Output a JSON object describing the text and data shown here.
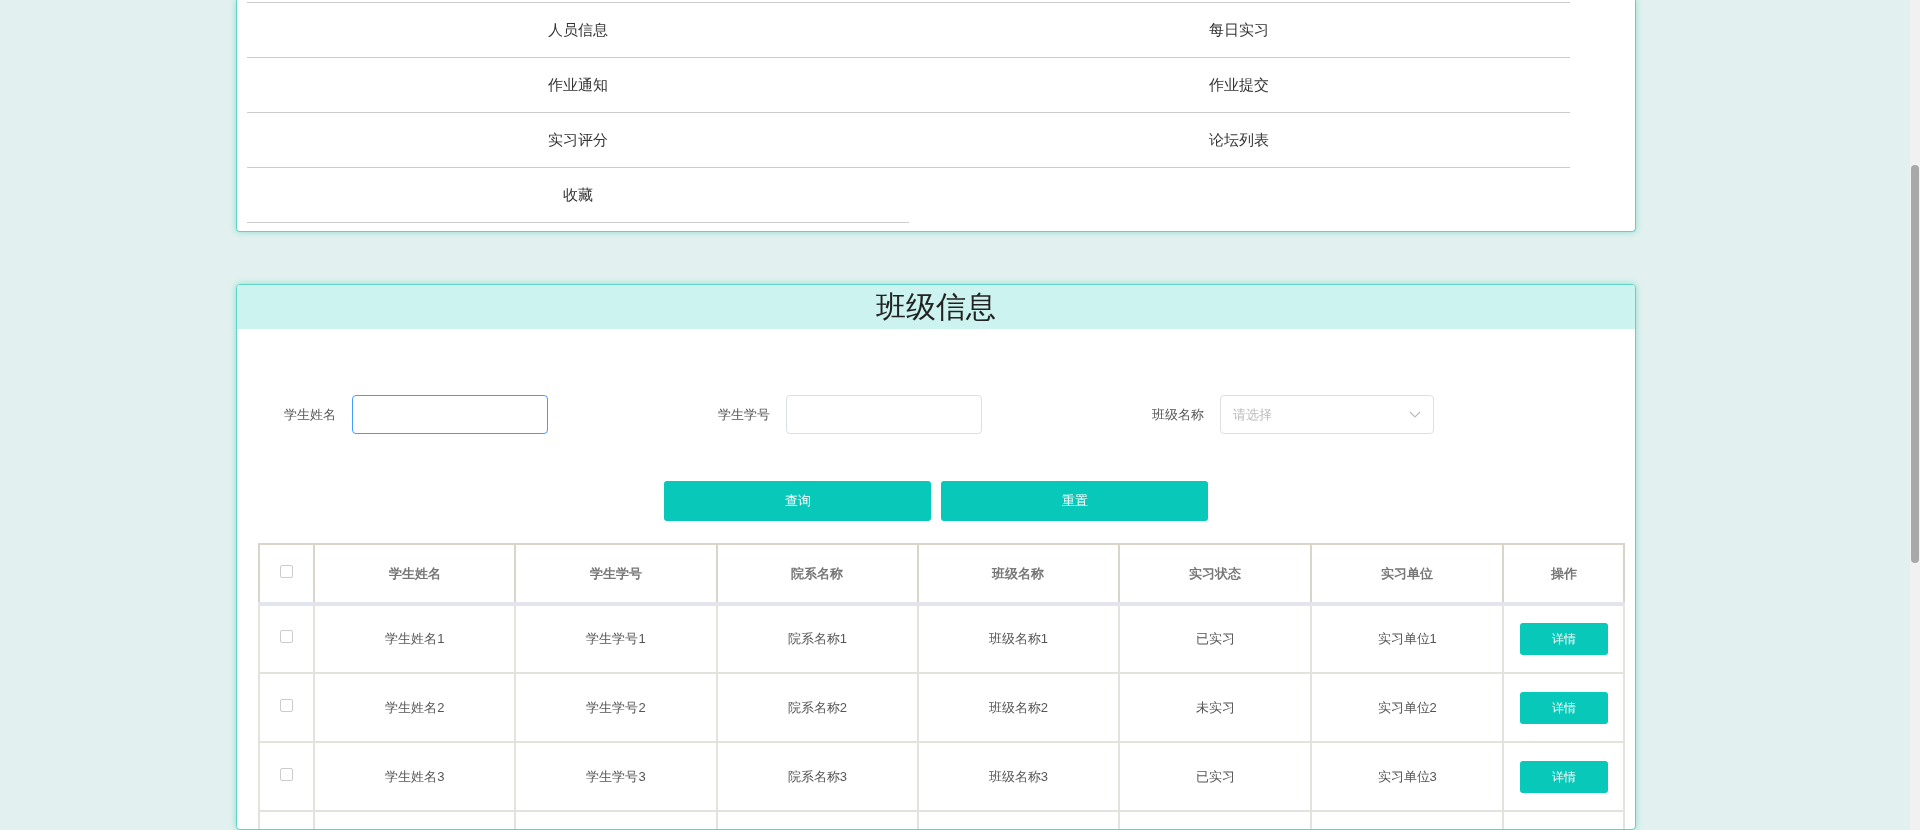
{
  "menu": {
    "items": [
      {
        "label": "人员信息"
      },
      {
        "label": "每日实习"
      },
      {
        "label": "作业通知"
      },
      {
        "label": "作业提交"
      },
      {
        "label": "实习评分"
      },
      {
        "label": "论坛列表"
      },
      {
        "label": "收藏"
      }
    ]
  },
  "panel": {
    "title": "班级信息"
  },
  "filters": [
    {
      "label": "学生姓名",
      "kind": "input",
      "focused": true
    },
    {
      "label": "学生学号",
      "kind": "input",
      "focused": false
    },
    {
      "label": "班级名称",
      "kind": "select",
      "placeholder": "请选择",
      "focused": false
    }
  ],
  "buttons": [
    "查询",
    "重置"
  ],
  "table": {
    "select_all": {
      "checked": false
    },
    "columns": [
      "学生姓名",
      "学生学号",
      "院系名称",
      "班级名称",
      "实习状态",
      "实习单位",
      "操作"
    ],
    "rows": [
      {
        "checked": false,
        "cells": [
          "学生姓名1",
          "学生学号1",
          "院系名称1",
          "班级名称1",
          "已实习",
          "实习单位1"
        ],
        "action": "详情"
      },
      {
        "checked": false,
        "cells": [
          "学生姓名2",
          "学生学号2",
          "院系名称2",
          "班级名称2",
          "未实习",
          "实习单位2"
        ],
        "action": "详情"
      },
      {
        "checked": false,
        "cells": [
          "学生姓名3",
          "学生学号3",
          "院系名称3",
          "班级名称3",
          "已实习",
          "实习单位3"
        ],
        "action": "详情"
      }
    ]
  }
}
